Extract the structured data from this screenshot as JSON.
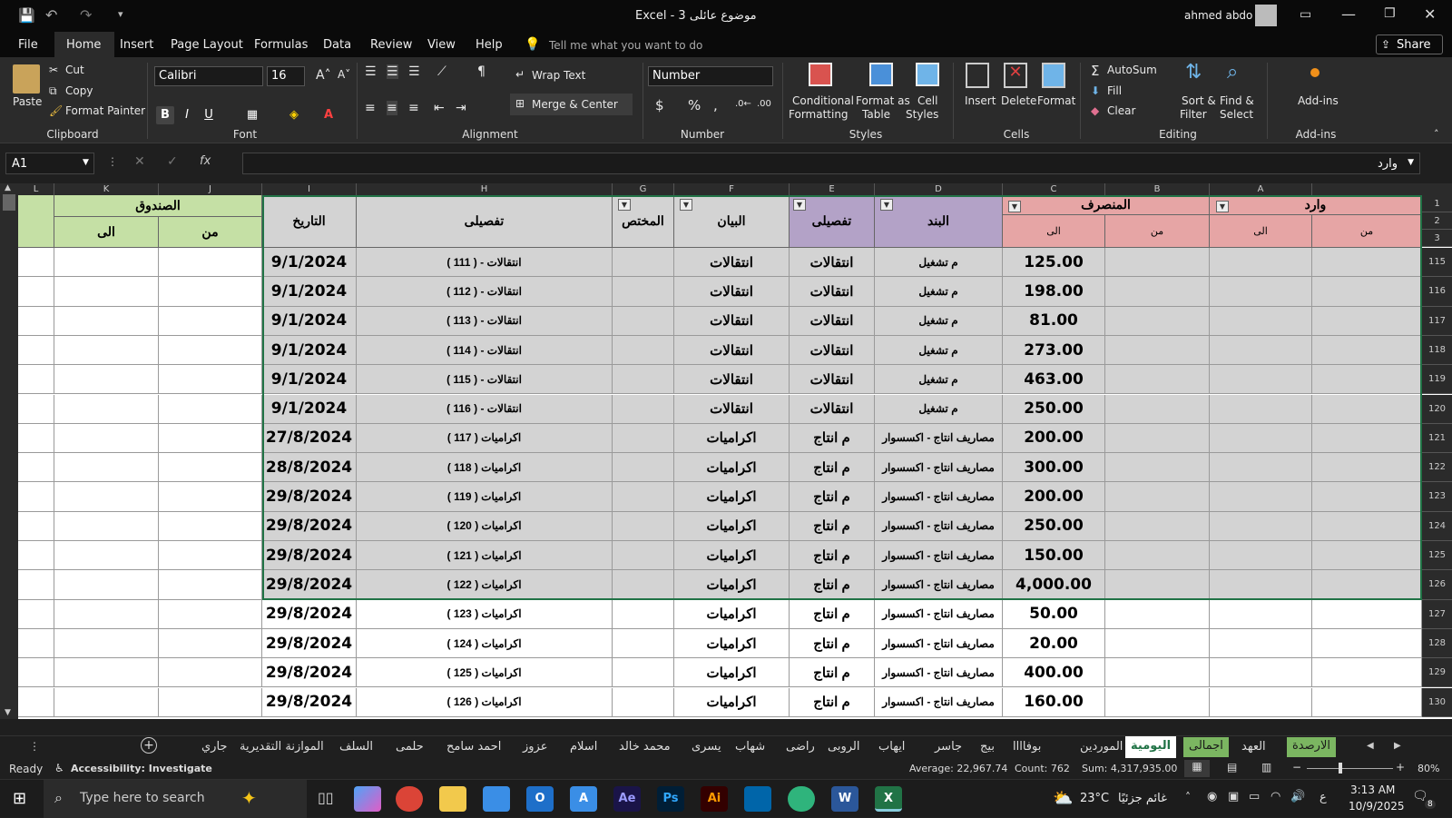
{
  "title": {
    "doc": "موضوع عائلى 3  -  Excel",
    "user": "ahmed abdo"
  },
  "menu": [
    "File",
    "Home",
    "Insert",
    "Page Layout",
    "Formulas",
    "Data",
    "Review",
    "View",
    "Help"
  ],
  "tellme": "Tell me what you want to do",
  "share": "Share",
  "ribbon": {
    "paste": "Paste",
    "cut": "Cut",
    "copy": "Copy",
    "format_painter": "Format Painter",
    "font_name": "Calibri",
    "font_size": "16",
    "wrap_text": "Wrap Text",
    "merge_center": "Merge & Center",
    "number_format": "Number",
    "conditional": "Conditional",
    "formatting": "Formatting",
    "format_as": "Format as",
    "table": "Table",
    "cell": "Cell",
    "styles": "Styles",
    "insert": "Insert",
    "delete": "Delete",
    "format": "Format",
    "autosum": "AutoSum",
    "fill": "Fill",
    "clear": "Clear",
    "sort_filter": "Sort &",
    "filter": "Filter",
    "find_select": "Find &",
    "select": "Select",
    "addins": "Add-ins",
    "groups": {
      "clipboard": "Clipboard",
      "font": "Font",
      "alignment": "Alignment",
      "number": "Number",
      "styles": "Styles",
      "cells": "Cells",
      "editing": "Editing",
      "addins": "Add-ins"
    }
  },
  "formula": {
    "namebox": "A1",
    "content": "وارد"
  },
  "headers": {
    "safe": "الصندوق",
    "to": "الى",
    "from": "من",
    "date": "التاريخ",
    "detail": "تفصيلى",
    "specialist": "المختص",
    "statement": "البيان",
    "detail2": "تفصيلى",
    "item": "البند",
    "expense": "المنصرف",
    "income": "وارد"
  },
  "col_letters": [
    "L",
    "K",
    "J",
    "I",
    "H",
    "G",
    "F",
    "E",
    "D",
    "C",
    "B",
    "A"
  ],
  "rows": [
    {
      "n": "115",
      "date": "9/1/2024",
      "detail": "انتقالات - ( 111 )",
      "statement": "انتقالات",
      "detail2": "انتقالات",
      "item": "م تشغيل",
      "amount": "125.00",
      "sel": true
    },
    {
      "n": "116",
      "date": "9/1/2024",
      "detail": "انتقالات - ( 112 )",
      "statement": "انتقالات",
      "detail2": "انتقالات",
      "item": "م تشغيل",
      "amount": "198.00",
      "sel": true
    },
    {
      "n": "117",
      "date": "9/1/2024",
      "detail": "انتقالات - ( 113 )",
      "statement": "انتقالات",
      "detail2": "انتقالات",
      "item": "م تشغيل",
      "amount": "81.00",
      "sel": true
    },
    {
      "n": "118",
      "date": "9/1/2024",
      "detail": "انتقالات - ( 114 )",
      "statement": "انتقالات",
      "detail2": "انتقالات",
      "item": "م تشغيل",
      "amount": "273.00",
      "sel": true
    },
    {
      "n": "119",
      "date": "9/1/2024",
      "detail": "انتقالات - ( 115 )",
      "statement": "انتقالات",
      "detail2": "انتقالات",
      "item": "م تشغيل",
      "amount": "463.00",
      "sel": true
    },
    {
      "n": "120",
      "date": "9/1/2024",
      "detail": "انتقالات - ( 116 )",
      "statement": "انتقالات",
      "detail2": "انتقالات",
      "item": "م تشغيل",
      "amount": "250.00",
      "sel": true
    },
    {
      "n": "121",
      "date": "27/8/2024",
      "detail": "اكراميات ( 117 )",
      "statement": "اكراميات",
      "detail2": "م انتاج",
      "item": "مصاريف انتاج - اكسسوار",
      "amount": "200.00",
      "sel": true
    },
    {
      "n": "122",
      "date": "28/8/2024",
      "detail": "اكراميات ( 118 )",
      "statement": "اكراميات",
      "detail2": "م انتاج",
      "item": "مصاريف انتاج - اكسسوار",
      "amount": "300.00",
      "sel": true
    },
    {
      "n": "123",
      "date": "29/8/2024",
      "detail": "اكراميات ( 119 )",
      "statement": "اكراميات",
      "detail2": "م انتاج",
      "item": "مصاريف انتاج - اكسسوار",
      "amount": "200.00",
      "sel": true
    },
    {
      "n": "124",
      "date": "29/8/2024",
      "detail": "اكراميات ( 120 )",
      "statement": "اكراميات",
      "detail2": "م انتاج",
      "item": "مصاريف انتاج - اكسسوار",
      "amount": "250.00",
      "sel": true
    },
    {
      "n": "125",
      "date": "29/8/2024",
      "detail": "اكراميات ( 121 )",
      "statement": "اكراميات",
      "detail2": "م انتاج",
      "item": "مصاريف انتاج - اكسسوار",
      "amount": "150.00",
      "sel": true
    },
    {
      "n": "126",
      "date": "29/8/2024",
      "detail": "اكراميات ( 122 )",
      "statement": "اكراميات",
      "detail2": "م انتاج",
      "item": "مصاريف انتاج - اكسسوار",
      "amount": "4,000.00",
      "sel": true
    },
    {
      "n": "127",
      "date": "29/8/2024",
      "detail": "اكراميات ( 123 )",
      "statement": "اكراميات",
      "detail2": "م انتاج",
      "item": "مصاريف انتاج - اكسسوار",
      "amount": "50.00",
      "sel": false
    },
    {
      "n": "128",
      "date": "29/8/2024",
      "detail": "اكراميات ( 124 )",
      "statement": "اكراميات",
      "detail2": "م انتاج",
      "item": "مصاريف انتاج - اكسسوار",
      "amount": "20.00",
      "sel": false
    },
    {
      "n": "129",
      "date": "29/8/2024",
      "detail": "اكراميات ( 125 )",
      "statement": "اكراميات",
      "detail2": "م انتاج",
      "item": "مصاريف انتاج - اكسسوار",
      "amount": "400.00",
      "sel": false
    },
    {
      "n": "130",
      "date": "29/8/2024",
      "detail": "اكراميات ( 126 )",
      "statement": "اكراميات",
      "detail2": "م انتاج",
      "item": "مصاريف انتاج - اكسسوار",
      "amount": "160.00",
      "sel": false
    }
  ],
  "sheet_tabs": [
    "جاري",
    "الموازنة التقديرية",
    "السلف",
    "حلمى",
    "احمد سامح",
    "عزوز",
    "اسلام",
    "محمد خالد",
    "يسرى",
    "شهاب",
    "راضى",
    "الروبى",
    "ايهاب",
    "جاسر",
    "بيج",
    "بوفاااا",
    "الموردين",
    "اليومية",
    "اجمالى",
    "العهد",
    "الارصدة"
  ],
  "status": {
    "ready": "Ready",
    "accessibility": "Accessibility: Investigate",
    "average": "Average: 22,967.74",
    "count": "Count: 762",
    "sum": "Sum: 4,317,935.00",
    "zoom": "80%"
  },
  "taskbar": {
    "search": "Type here to search",
    "temp": "23°C",
    "weather": "غائم جزئيًا",
    "lang": "ع",
    "time": "3:13 AM",
    "date": "10/9/2025",
    "notif": "8"
  },
  "colors": {
    "green_header": "#c5e0a5",
    "pink_header": "#e6a5a5",
    "purple_header": "#b3a2c7",
    "selected_fill": "#d3d3d3",
    "accent": "#217346"
  }
}
